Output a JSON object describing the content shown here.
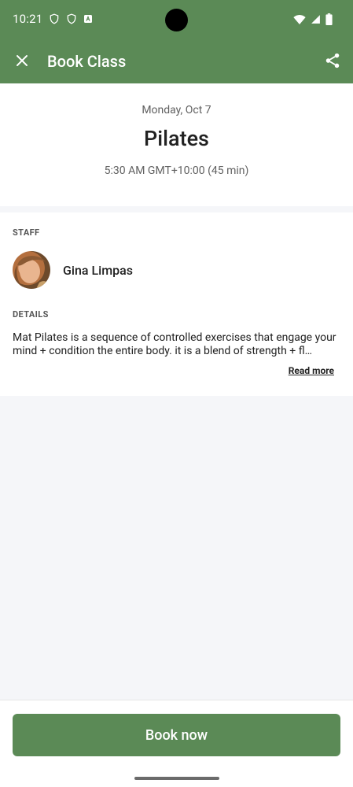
{
  "status_bar": {
    "time": "10:21"
  },
  "app_bar": {
    "title": "Book Class",
    "close_icon": "close-icon",
    "share_icon": "share-icon"
  },
  "class_info": {
    "date": "Monday, Oct 7",
    "name": "Pilates",
    "time": "5:30 AM GMT+10:00 (45 min)"
  },
  "staff": {
    "label": "STAFF",
    "name": "Gina Limpas"
  },
  "details": {
    "label": "DETAILS",
    "text": "Mat Pilates is a sequence of controlled exercises that engage your mind + condition the entire body. it is a blend of strength + fl…",
    "read_more": "Read more"
  },
  "actions": {
    "book_now": "Book now"
  },
  "colors": {
    "brand": "#5b8a56",
    "background": "#f5f6f9"
  }
}
